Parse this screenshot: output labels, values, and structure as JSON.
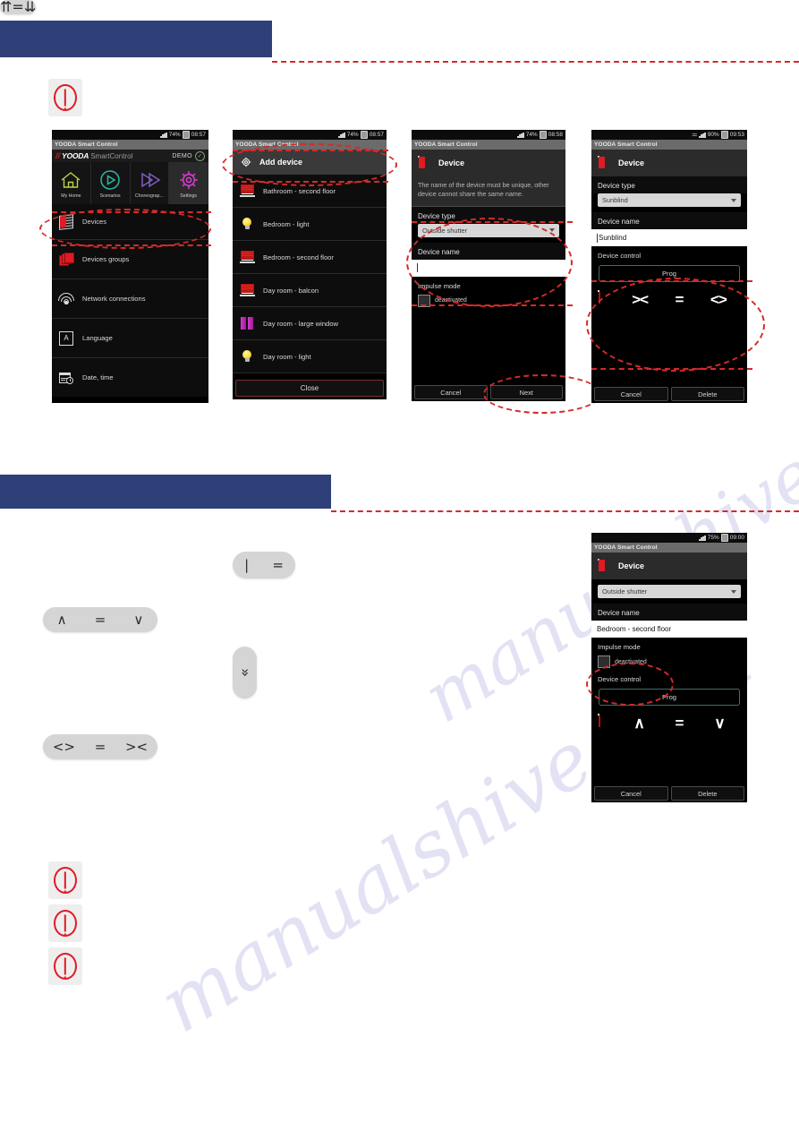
{
  "page": {
    "accent_blue": "#2f3f78",
    "annotation_red": "#d42a2a",
    "brand_red": "#e01b24"
  },
  "section_headers": [
    {
      "name": "section-header-1",
      "text": ""
    },
    {
      "name": "section-header-2",
      "text": ""
    }
  ],
  "phone1": {
    "status": {
      "battery": "74%",
      "time": "08:57"
    },
    "app_bar": "YOODA Smart Control",
    "brand": {
      "mark": "YOODA",
      "suffix": "SmartControl",
      "demo": "DEMO",
      "check": "✓"
    },
    "tabs": [
      {
        "label": "My Home",
        "icon": "home-icon"
      },
      {
        "label": "Scenarios",
        "icon": "play-circle-icon"
      },
      {
        "label": "Choreograp...",
        "icon": "fast-forward-icon"
      },
      {
        "label": "Settings",
        "icon": "gear-icon"
      }
    ],
    "menu": [
      {
        "label": "Devices",
        "icon": "devices-icon"
      },
      {
        "label": "Devices groups",
        "icon": "device-groups-icon"
      },
      {
        "label": "Network connections",
        "icon": "wifi-icon"
      },
      {
        "label": "Language",
        "icon": "language-icon"
      },
      {
        "label": "Date, time",
        "icon": "date-time-icon"
      }
    ]
  },
  "phone2": {
    "status": {
      "battery": "74%",
      "time": "08:57"
    },
    "app_bar": "YOODA Smart Control",
    "add_device": {
      "label": "Add device",
      "icon": "gear-icon"
    },
    "devices": [
      {
        "label": "Bathroom - second floor",
        "icon": "shutter-icon"
      },
      {
        "label": "Bedroom - light",
        "icon": "bulb-icon"
      },
      {
        "label": "Bedroom - second floor",
        "icon": "shutter-icon"
      },
      {
        "label": "Day room - balcon",
        "icon": "shutter-icon"
      },
      {
        "label": "Day room - large window",
        "icon": "sunblind-icon"
      },
      {
        "label": "Day room - light",
        "icon": "bulb-icon"
      }
    ],
    "close_label": "Close"
  },
  "phone3": {
    "status": {
      "battery": "74%",
      "time": "08:58"
    },
    "app_bar": "YOODA Smart Control",
    "title": "Device",
    "hint": "The name of the device must be unique, other device cannot share the same name.",
    "device_type_label": "Device type",
    "device_type_value": "Outside shutter",
    "device_name_label": "Device name",
    "device_name_value": "",
    "impulse_label": "Impulse mode",
    "impulse_checkbox_label": "deactivated",
    "buttons": {
      "cancel": "Cancel",
      "next": "Next"
    }
  },
  "phone4": {
    "status": {
      "battery": "90%",
      "time": "09:53",
      "wifi": true
    },
    "app_bar": "YOODA Smart Control",
    "title": "Device",
    "device_type_label": "Device type",
    "device_type_value": "Sunblind",
    "device_name_label": "Device name",
    "device_name_value": "Sunblind",
    "device_control_label": "Device control",
    "prog_label": "Prog",
    "control_glyphs": [
      "><",
      "=",
      "<>"
    ],
    "buttons": {
      "cancel": "Cancel",
      "delete": "Delete"
    }
  },
  "phone5": {
    "status": {
      "battery": "75%",
      "time": "09:00"
    },
    "app_bar": "YOODA Smart Control",
    "title": "Device",
    "device_type_value": "Outside shutter",
    "device_name_label": "Device name",
    "device_name_value": "Bedroom - second floor",
    "impulse_label": "Impulse mode",
    "impulse_checkbox_label": "deactivated",
    "device_control_label": "Device control",
    "prog_label": "Prog",
    "control_glyphs": [
      "∧",
      "=",
      "∨"
    ],
    "buttons": {
      "cancel": "Cancel",
      "delete": "Delete"
    }
  },
  "legend_pills": [
    {
      "name": "pill-up-stop-down",
      "glyphs": [
        "∧",
        "=",
        "∨"
      ]
    },
    {
      "name": "pill-open-stop-close",
      "glyphs": [
        "<>",
        "=",
        "><"
      ]
    },
    {
      "name": "pill-bar-stop",
      "glyphs": [
        "|",
        "="
      ]
    },
    {
      "name": "pill-double-chevron-vertical",
      "glyphs": [
        "»"
      ]
    },
    {
      "name": "pill-double-up-stop-down",
      "glyphs": [
        "⇈",
        "=",
        "⇊"
      ]
    }
  ],
  "warnings": [
    {
      "name": "warning-icon-1"
    },
    {
      "name": "warning-icon-2"
    },
    {
      "name": "warning-icon-3"
    },
    {
      "name": "warning-icon-4"
    }
  ],
  "watermark": "manualshive.com"
}
